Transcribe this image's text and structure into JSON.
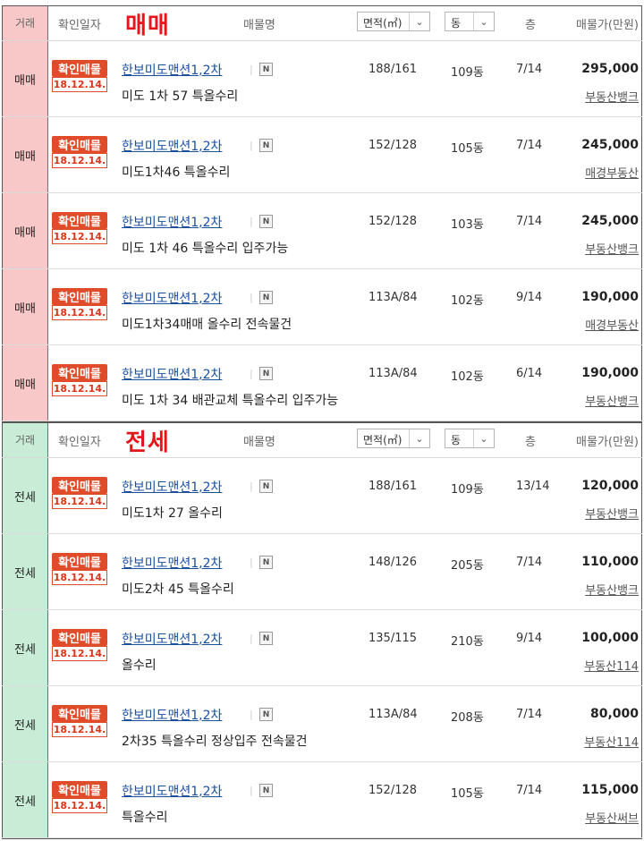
{
  "headers": {
    "trade": "거래",
    "date": "확인일자",
    "name": "매물명",
    "area": "면적(㎡)",
    "dong": "동",
    "floor": "층",
    "price": "매물가(만원)"
  },
  "icons": {
    "dropdown": "chevron-down-icon",
    "naver": "naver-n-icon"
  },
  "colors": {
    "sale": "#f8c8c8",
    "jeonse": "#c8ecd6",
    "badge": "#e04b2a",
    "title": "#e8141b"
  },
  "sale": {
    "title": "매매",
    "rows": [
      {
        "type": "매매",
        "badge_top": "확인매물",
        "badge_date": "18.12.14.",
        "name": "한보미도맨션1,2차",
        "desc": "미도 1차 57 특올수리",
        "area": "188/161",
        "dong": "109동",
        "floor": "7/14",
        "price": "295,000",
        "agency": "부동산뱅크"
      },
      {
        "type": "매매",
        "badge_top": "확인매물",
        "badge_date": "18.12.14.",
        "name": "한보미도맨션1,2차",
        "desc": "미도1차46 특올수리",
        "area": "152/128",
        "dong": "105동",
        "floor": "7/14",
        "price": "245,000",
        "agency": "매경부동산"
      },
      {
        "type": "매매",
        "badge_top": "확인매물",
        "badge_date": "18.12.14.",
        "name": "한보미도맨션1,2차",
        "desc": "미도 1차 46 특올수리 입주가능",
        "area": "152/128",
        "dong": "103동",
        "floor": "7/14",
        "price": "245,000",
        "agency": "부동산뱅크"
      },
      {
        "type": "매매",
        "badge_top": "확인매물",
        "badge_date": "18.12.14.",
        "name": "한보미도맨션1,2차",
        "desc": "미도1차34매매 올수리 전속물건",
        "area": "113A/84",
        "dong": "102동",
        "floor": "9/14",
        "price": "190,000",
        "agency": "매경부동산"
      },
      {
        "type": "매매",
        "badge_top": "확인매물",
        "badge_date": "18.12.14.",
        "name": "한보미도맨션1,2차",
        "desc": "미도 1차 34 배관교체 특올수리 입주가능",
        "area": "113A/84",
        "dong": "102동",
        "floor": "6/14",
        "price": "190,000",
        "agency": "부동산뱅크"
      }
    ]
  },
  "jeonse": {
    "title": "전세",
    "rows": [
      {
        "type": "전세",
        "badge_top": "확인매물",
        "badge_date": "18.12.14.",
        "name": "한보미도맨션1,2차",
        "desc": "미도1차 27 올수리",
        "area": "188/161",
        "dong": "109동",
        "floor": "13/14",
        "price": "120,000",
        "agency": "부동산뱅크"
      },
      {
        "type": "전세",
        "badge_top": "확인매물",
        "badge_date": "18.12.14.",
        "name": "한보미도맨션1,2차",
        "desc": "미도2차 45 특올수리",
        "area": "148/126",
        "dong": "205동",
        "floor": "7/14",
        "price": "110,000",
        "agency": "부동산뱅크"
      },
      {
        "type": "전세",
        "badge_top": "확인매물",
        "badge_date": "18.12.14.",
        "name": "한보미도맨션1,2차",
        "desc": "올수리",
        "area": "135/115",
        "dong": "210동",
        "floor": "9/14",
        "price": "100,000",
        "agency": "부동산114"
      },
      {
        "type": "전세",
        "badge_top": "확인매물",
        "badge_date": "18.12.14.",
        "name": "한보미도맨션1,2차",
        "desc": "2차35 특올수리 정상입주 전속물건",
        "area": "113A/84",
        "dong": "208동",
        "floor": "7/14",
        "price": "80,000",
        "agency": "부동산114"
      },
      {
        "type": "전세",
        "badge_top": "확인매물",
        "badge_date": "18.12.14.",
        "name": "한보미도맨션1,2차",
        "desc": "특올수리",
        "area": "152/128",
        "dong": "105동",
        "floor": "7/14",
        "price": "115,000",
        "agency": "부동산써브"
      }
    ]
  }
}
